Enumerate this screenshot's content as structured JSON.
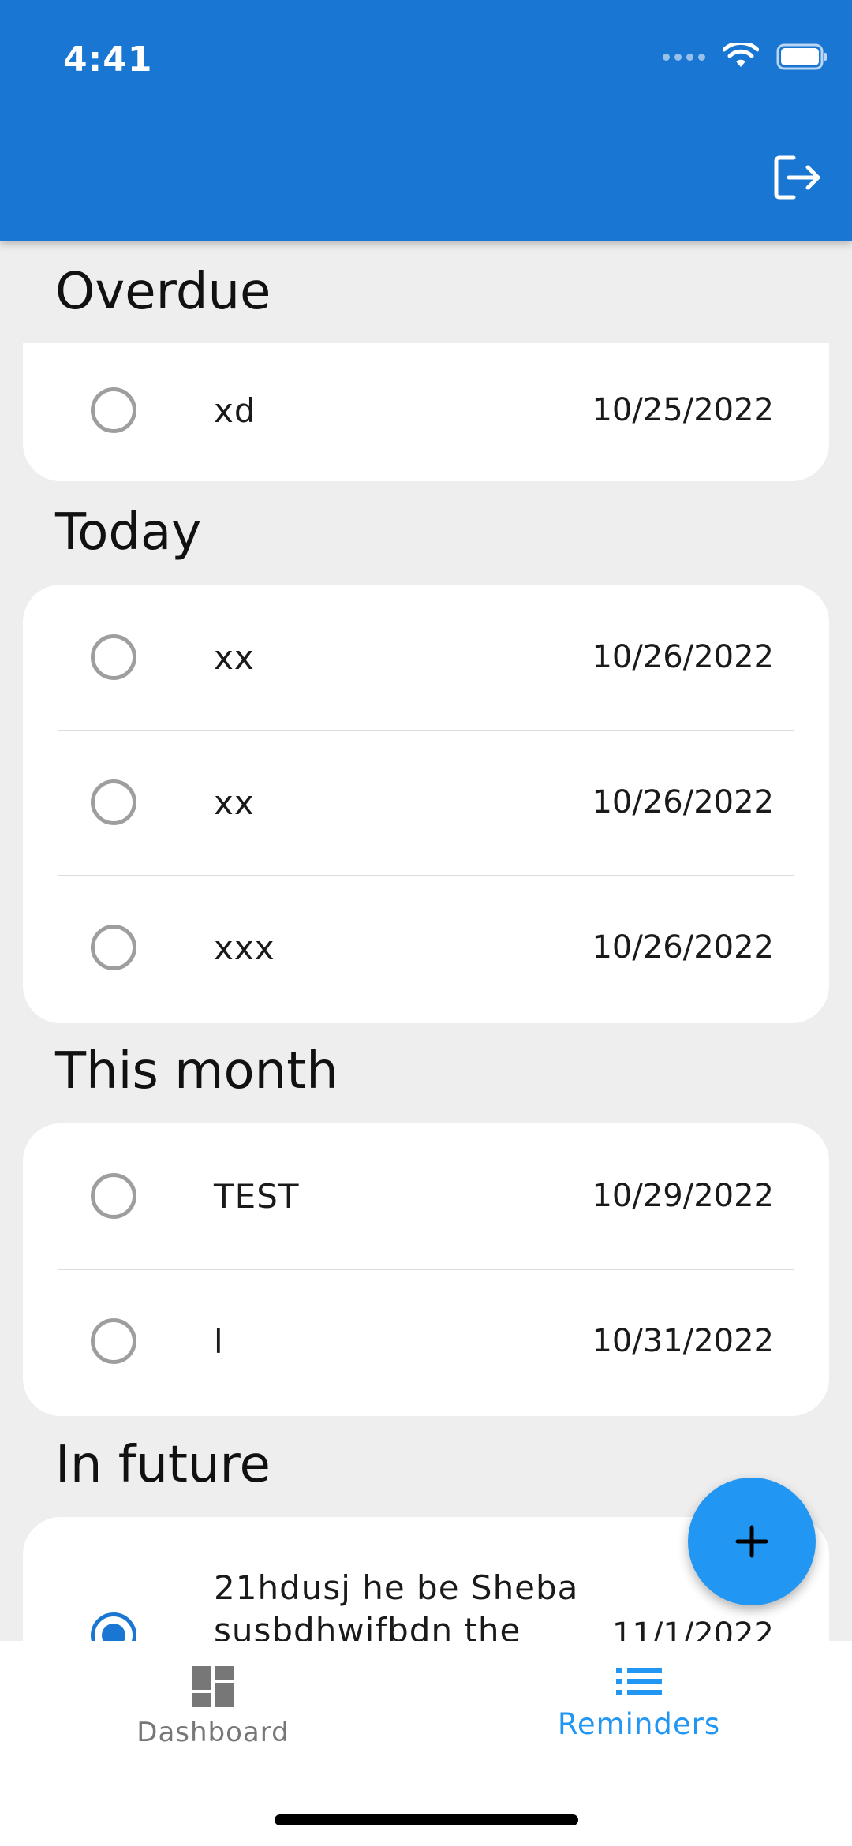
{
  "status_bar": {
    "time": "4:41"
  },
  "app_bar": {
    "logout_icon": "logout-icon"
  },
  "sections": [
    {
      "title": "Overdue",
      "items": [
        {
          "title": "xd",
          "date": "10/25/2022",
          "done": false
        }
      ]
    },
    {
      "title": "Today",
      "items": [
        {
          "title": "xx",
          "date": "10/26/2022",
          "done": false
        },
        {
          "title": "xx",
          "date": "10/26/2022",
          "done": false
        },
        {
          "title": "xxx",
          "date": "10/26/2022",
          "done": false
        }
      ]
    },
    {
      "title": "This month",
      "items": [
        {
          "title": "TEST",
          "date": "10/29/2022",
          "done": false
        },
        {
          "title": "l",
          "date": "10/31/2022",
          "done": false
        }
      ]
    },
    {
      "title": "In future",
      "items": [
        {
          "title_line1": "21hdusj he be Sheba",
          "title_line2": "susbdhwifbdn  the",
          "date": "11/1/2022",
          "done": true
        }
      ]
    }
  ],
  "fab": {
    "icon": "plus-icon"
  },
  "bottom_nav": {
    "items": [
      {
        "label": "Dashboard",
        "icon": "dashboard-icon",
        "active": false
      },
      {
        "label": "Reminders",
        "icon": "list-icon",
        "active": true
      }
    ]
  },
  "colors": {
    "primary": "#1976d2",
    "accent": "#2196f3",
    "background": "#eeeeee"
  }
}
